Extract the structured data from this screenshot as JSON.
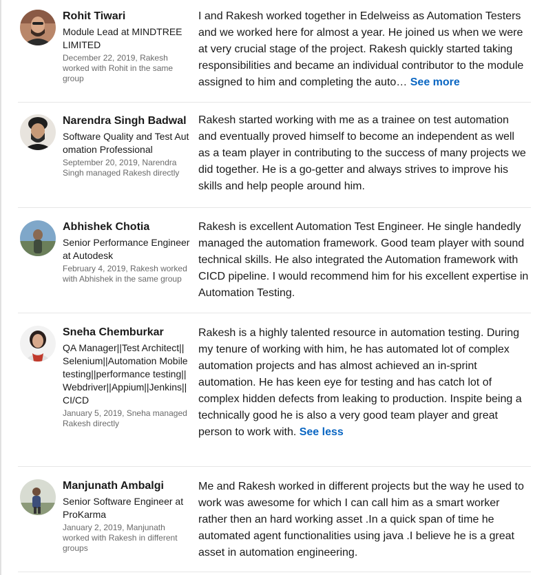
{
  "recommendations": [
    {
      "name": "Rohit Tiwari",
      "headline": "Module Lead at MINDTREE LIMITED",
      "meta": "December 22, 2019, Rakesh worked with Rohit in the same group",
      "text": "I and Rakesh worked together in Edelweiss as Automation Testers and we worked here for almost a year. He joined us when we were at very crucial stage of the project. Rakesh quickly started taking responsibilities and became an individual contributor to the module assigned to him and completing the auto…",
      "toggle": "See more"
    },
    {
      "name": "Narendra Singh Badwal",
      "headline": "Software Quality and Test Automation Professional",
      "meta": "September 20, 2019, Narendra Singh managed Rakesh directly",
      "text": "Rakesh started working with me as a trainee on test automation and eventually proved himself to become an independent as well as a team player in contributing to the success of many projects we did together. He is a go-getter and always strives to improve his skills and help people around him.",
      "toggle": ""
    },
    {
      "name": "Abhishek Chotia",
      "headline": "Senior Performance Engineer at Autodesk",
      "meta": "February 4, 2019, Rakesh worked with Abhishek in the same group",
      "text": "Rakesh is excellent Automation Test Engineer. He single handedly managed the automation framework. Good team player with sound technical skills. He also integrated the Automation framework with CICD pipeline. I would recommend him for his excellent expertise in Automation Testing.",
      "toggle": ""
    },
    {
      "name": "Sneha Chemburkar",
      "headline": "QA Manager||Test Architect||Selenium||Automation Mobile testing||performance testing|| Webdriver||Appium||Jenkins||CI/CD",
      "meta": "January 5, 2019, Sneha managed Rakesh directly",
      "text": "Rakesh is a highly talented resource in automation testing. During my tenure of working with him, he has automated lot of complex automation projects and has almost achieved an in-sprint automation. He has keen eye for testing and has catch lot of complex hidden defects from leaking to production. Inspite being a technically good he is also a very good team player and great person to work with.",
      "toggle": "See less"
    },
    {
      "name": "Manjunath Ambalgi",
      "headline": "Senior Software Engineer at ProKarma",
      "meta": "January 2, 2019, Manjunath worked with Rakesh in different groups",
      "text": "Me and Rakesh worked in different projects but the way he used to work was awesome for which I can call him as a smart worker rather then an hard working asset .In a quick span of time he automated agent functionalities using java .I believe he is a great asset in automation engineering.",
      "toggle": ""
    }
  ],
  "colors": {
    "link": "#0a66c2",
    "divider": "#e6e6e6",
    "meta_text": "#666666"
  },
  "icons": [
    "profile-photo-rohit",
    "profile-photo-narendra",
    "profile-photo-abhishek",
    "profile-photo-sneha",
    "profile-photo-manjunath"
  ]
}
